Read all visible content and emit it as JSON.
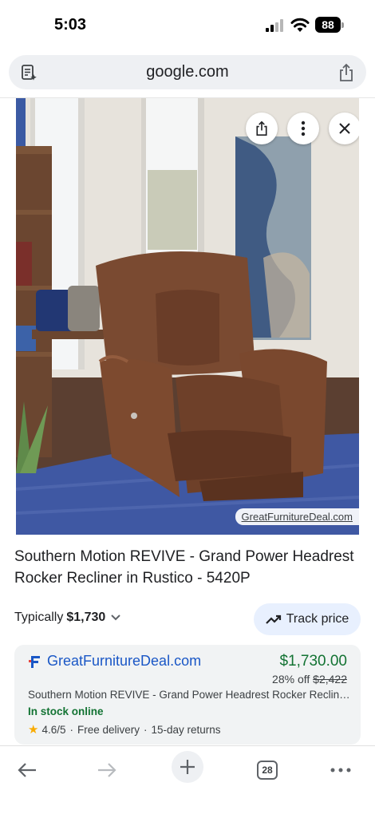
{
  "status_bar": {
    "time": "5:03",
    "battery": "88"
  },
  "url_bar": {
    "url": "google.com"
  },
  "image": {
    "watermark": "GreatFurnitureDeal.com"
  },
  "product": {
    "title": "Southern Motion REVIVE - Grand Power Headrest Rocker Recliner in Rustico - 5420P"
  },
  "price_row": {
    "typically_label": "Typically",
    "typical_price": "$1,730",
    "track_label": "Track price"
  },
  "merchant": {
    "name": "GreatFurnitureDeal.com",
    "price": "$1,730.00",
    "discount": "28% off",
    "original_price": "$2,422",
    "description": "Southern Motion REVIVE - Grand Power Headrest Rocker Recline…",
    "stock": "In stock online",
    "rating": "4.6/5",
    "delivery": "Free delivery",
    "returns": "15-day returns",
    "separator": "·"
  },
  "toolbar": {
    "tab_count": "28"
  },
  "colors": {
    "price_green": "#137333",
    "link_blue": "#1a57c6",
    "track_bg": "#e8f0fe",
    "card_bg": "#f1f3f4"
  },
  "icons": [
    "reader-mode-icon",
    "share-icon",
    "close-icon",
    "more-vert-icon",
    "trending-icon",
    "chevron-down-icon",
    "back-arrow-icon",
    "forward-arrow-icon",
    "plus-icon",
    "tabs-icon",
    "more-horiz-icon",
    "star-icon"
  ]
}
